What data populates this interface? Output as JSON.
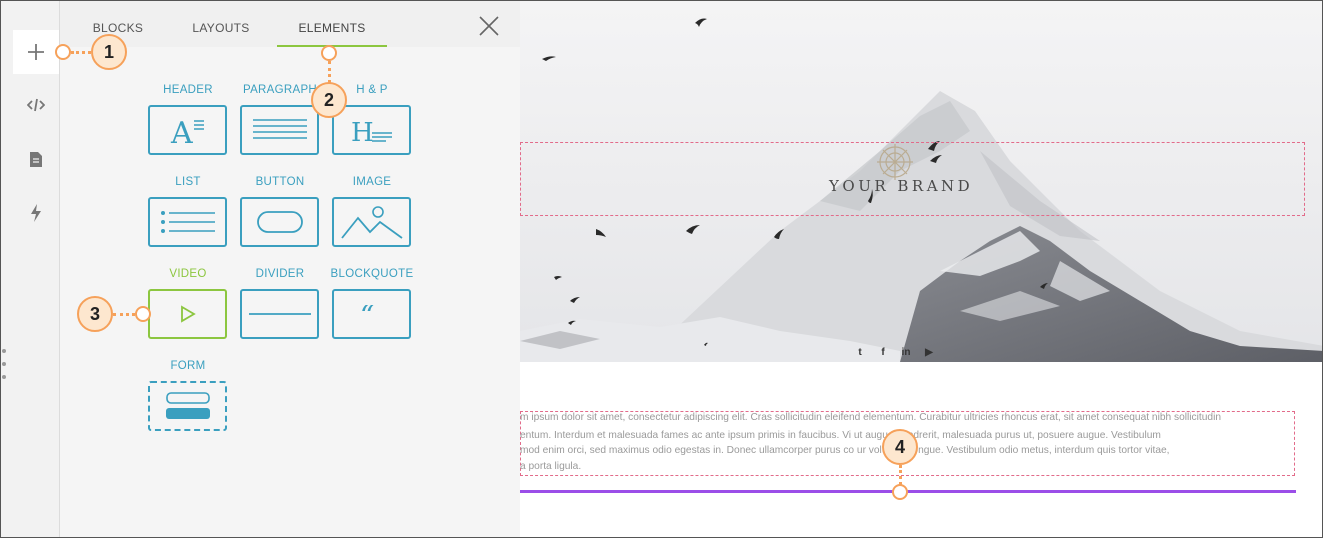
{
  "tabs": [
    {
      "label": "BLOCKS",
      "active": false
    },
    {
      "label": "LAYOUTS",
      "active": false
    },
    {
      "label": "ELEMENTS",
      "active": true
    }
  ],
  "rail": {
    "items": [
      {
        "icon": "plus-icon",
        "active": true
      },
      {
        "icon": "code-icon",
        "active": false
      },
      {
        "icon": "document-icon",
        "active": false
      },
      {
        "icon": "lightning-icon",
        "active": false
      }
    ]
  },
  "elements": [
    {
      "label": "HEADER",
      "icon": "header-icon"
    },
    {
      "label": "PARAGRAPH",
      "icon": "paragraph-icon"
    },
    {
      "label": "H & P",
      "icon": "heading-paragraph-icon"
    },
    {
      "label": "LIST",
      "icon": "list-icon"
    },
    {
      "label": "BUTTON",
      "icon": "button-icon"
    },
    {
      "label": "IMAGE",
      "icon": "image-icon"
    },
    {
      "label": "VIDEO",
      "icon": "video-icon",
      "highlighted": true
    },
    {
      "label": "DIVIDER",
      "icon": "divider-icon"
    },
    {
      "label": "BLOCKQUOTE",
      "icon": "blockquote-icon"
    },
    {
      "label": "FORM",
      "icon": "form-icon"
    }
  ],
  "callouts": [
    "1",
    "2",
    "3",
    "4"
  ],
  "canvas": {
    "brand": "YOUR BRAND",
    "social": [
      "t",
      "f",
      "in",
      "▶"
    ],
    "paragraph_lines": [
      "m ipsum dolor sit amet, consectetur adipiscing elit. Cras sollicitudin eleifend elementum. Curabitur ultricies rhoncus erat, sit amet consequat nibh sollicitudin",
      "entum. Interdum et malesuada fames ac ante ipsum primis in faucibus. Vi                   ut augue hendrerit, malesuada purus ut, posuere augue. Vestibulum",
      "mod enim orci, sed maximus odio egestas in. Donec ullamcorper purus co                 ur volutpat congue. Vestibulum odio metus, interdum quis tortor vitae,",
      "a porta ligula."
    ]
  },
  "colors": {
    "accent_blue": "#3a9fbf",
    "accent_green": "#8cc63f",
    "callout_orange": "#f6a15a",
    "selection_pink": "#e26b8a",
    "divider_purple": "#9b4ee8"
  }
}
